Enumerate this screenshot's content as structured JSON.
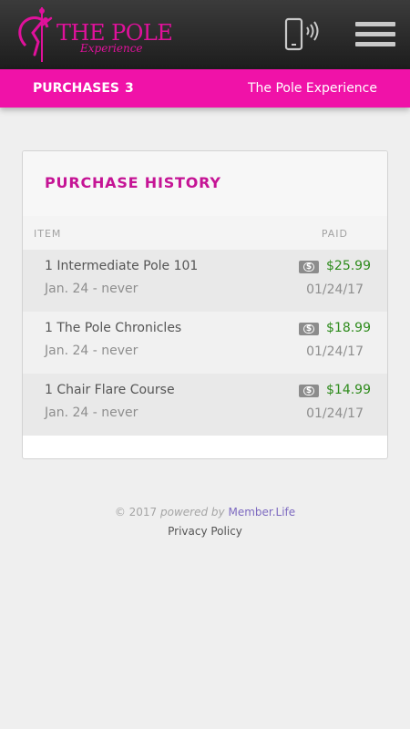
{
  "header": {
    "logo_main": "THE POLE",
    "logo_sub": "Experience",
    "brand_color": "#e0119b"
  },
  "subnav": {
    "label": "PURCHASES",
    "count": "3",
    "site_name": "The Pole Experience",
    "bar_color": "#f012a8"
  },
  "card": {
    "title": "PURCHASE HISTORY",
    "columns": {
      "item": "ITEM",
      "paid": "PAID"
    },
    "rows": [
      {
        "name": "1 Intermediate Pole 101",
        "sub": "Jan. 24 - never",
        "icon": "money-icon",
        "price": "$25.99",
        "date": "01/24/17"
      },
      {
        "name": "1 The Pole Chronicles",
        "sub": "Jan. 24 - never",
        "icon": "money-icon",
        "price": "$18.99",
        "date": "01/24/17"
      },
      {
        "name": "1 Chair Flare Course",
        "sub": "Jan. 24 - never",
        "icon": "money-icon",
        "price": "$14.99",
        "date": "01/24/17"
      }
    ]
  },
  "footer": {
    "copyright": "© 2017",
    "powered_by": "powered by",
    "brand": "Member.Life",
    "privacy": "Privacy Policy"
  },
  "icons": {
    "phone": "phone-ringing-icon",
    "menu": "hamburger-menu-icon",
    "money": "dollar-bill-icon"
  }
}
